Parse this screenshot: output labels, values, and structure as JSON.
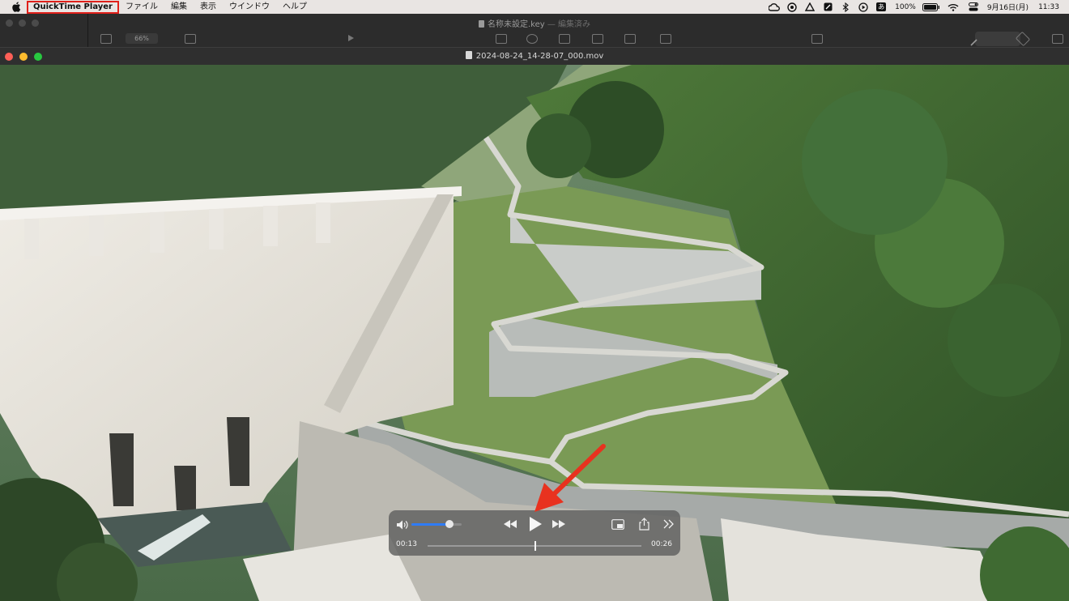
{
  "menubar": {
    "apple_icon": "apple-logo",
    "app_name": "QuickTime Player",
    "menus": [
      "ファイル",
      "編集",
      "表示",
      "ウインドウ",
      "ヘルプ"
    ],
    "status": {
      "battery": "100%",
      "date": "9月16日(月)",
      "time": "11:33",
      "icons": [
        "creative-cloud-icon",
        "screen-record-icon",
        "drive-icon",
        "notes-icon",
        "bluetooth-icon",
        "play-circle-icon",
        "input-method-icon",
        "battery-icon",
        "wifi-icon",
        "control-center-icon"
      ],
      "input_method": "あ"
    }
  },
  "keynote_window": {
    "title": "名称未設定.key",
    "separator": "—",
    "edited": "編集済み",
    "zoom": "66%"
  },
  "quicktime_window": {
    "title": "2024-08-24_14-28-07_000.mov"
  },
  "player": {
    "current_time": "00:13",
    "duration": "00:26",
    "progress": 0.5,
    "volume": 0.75,
    "play_icon": "play-icon",
    "rewind_icon": "rewind-icon",
    "forward_icon": "fast-forward-icon",
    "pip_icon": "picture-in-picture-icon",
    "share_icon": "share-icon",
    "more_icon": "more-chevrons-icon"
  },
  "colors": {
    "menu_highlight": "#e0201a",
    "arrow": "#e8321f",
    "volume_fill": "#2f7cf6"
  }
}
